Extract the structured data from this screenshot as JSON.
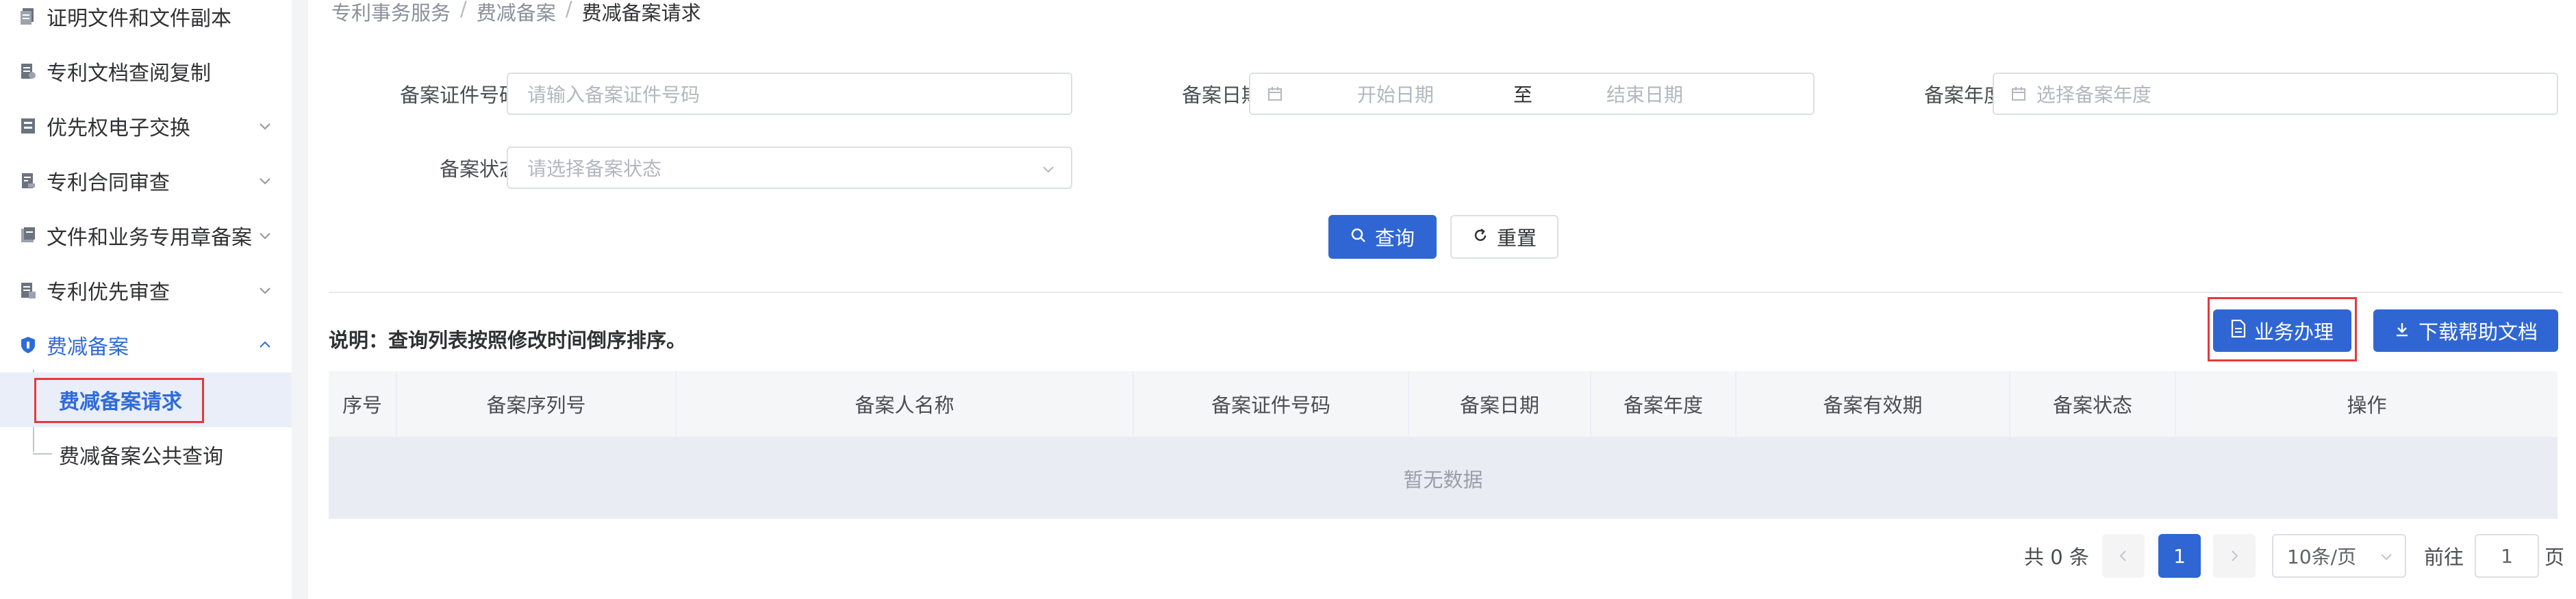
{
  "sidebar": {
    "items": [
      {
        "label": "证明文件和文件副本",
        "icon": "document-copy-icon",
        "has_arrow": false
      },
      {
        "label": "专利文档查阅复制",
        "icon": "document-view-icon",
        "has_arrow": false
      },
      {
        "label": "优先权电子交换",
        "icon": "exchange-icon",
        "has_arrow": true
      },
      {
        "label": "专利合同审查",
        "icon": "contract-icon",
        "has_arrow": true
      },
      {
        "label": "文件和业务专用章备案",
        "icon": "seal-icon",
        "has_arrow": true
      },
      {
        "label": "专利优先审查",
        "icon": "priority-icon",
        "has_arrow": true
      },
      {
        "label": "费减备案",
        "icon": "fee-shield-icon",
        "has_arrow": true
      }
    ],
    "sub_items": [
      {
        "label": "费减备案请求",
        "active": true
      },
      {
        "label": "费减备案公共查询",
        "active": false
      }
    ]
  },
  "breadcrumb": [
    "专利事务服务",
    "费减备案",
    "费减备案请求"
  ],
  "breadcrumb_sep": "/",
  "form": {
    "cert_no": {
      "label": "备案证件号码",
      "placeholder": "请输入备案证件号码",
      "value": ""
    },
    "date": {
      "label": "备案日期",
      "start_placeholder": "开始日期",
      "range_sep": "至",
      "end_placeholder": "结束日期"
    },
    "year": {
      "label": "备案年度",
      "placeholder": "选择备案年度",
      "value": ""
    },
    "status": {
      "label": "备案状态",
      "placeholder": "请选择备案状态",
      "value": ""
    }
  },
  "buttons": {
    "search": "查询",
    "reset": "重置",
    "handle": "业务办理",
    "download": "下载帮助文档"
  },
  "note": "说明：查询列表按照修改时间倒序排序。",
  "table": {
    "columns": [
      "序号",
      "备案序列号",
      "备案人名称",
      "备案证件号码",
      "备案日期",
      "备案年度",
      "备案有效期",
      "备案状态",
      "操作"
    ],
    "rows": [],
    "empty_text": "暂无数据"
  },
  "pagination": {
    "total_text": "共 0 条",
    "current_page": "1",
    "page_size": "10条/页",
    "goto_prefix": "前往",
    "goto_value": "1",
    "goto_suffix": "页"
  },
  "colors": {
    "primary": "#2f66d3",
    "active_text": "#2f6bd8",
    "highlight_box": "#e4393c"
  }
}
